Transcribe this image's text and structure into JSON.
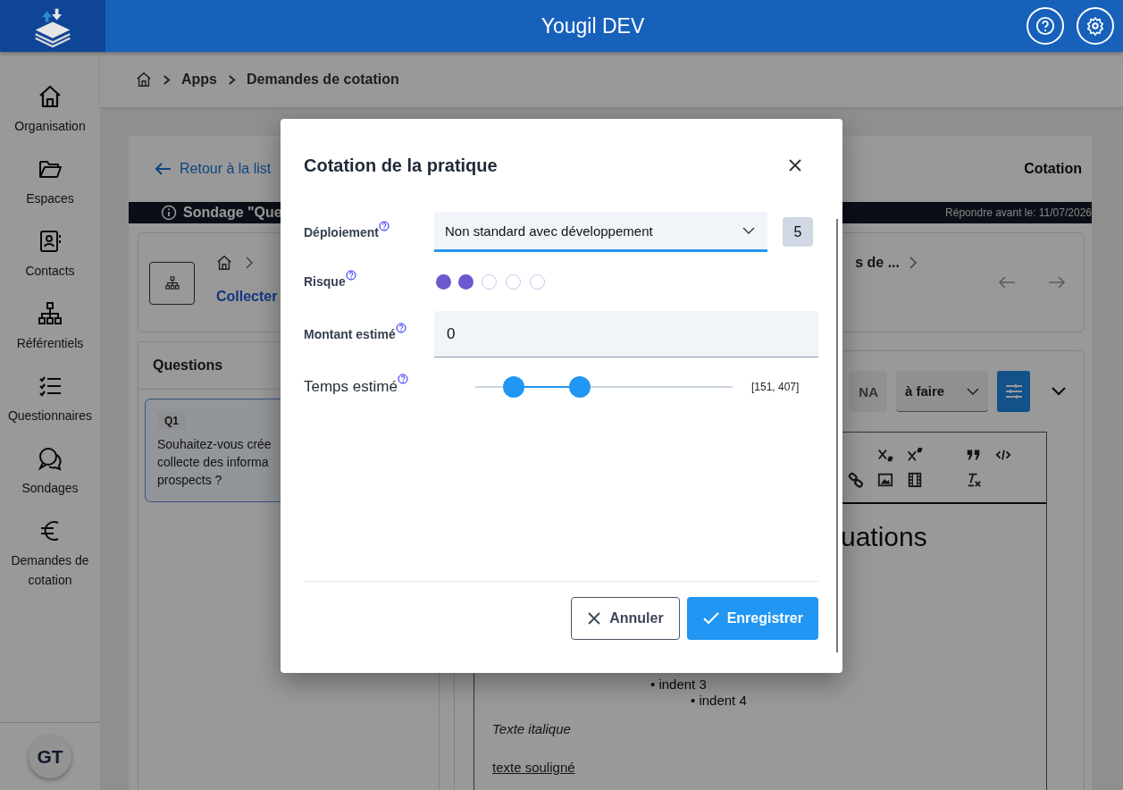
{
  "header": {
    "title": "Yougil DEV"
  },
  "sidebar": {
    "items": [
      {
        "label": "Organisation",
        "kind": "home"
      },
      {
        "label": "Espaces",
        "kind": "folder"
      },
      {
        "label": "Contacts",
        "kind": "contact"
      },
      {
        "label": "Référentiels",
        "kind": "tree"
      },
      {
        "label": "Questionnaires",
        "kind": "checklist"
      },
      {
        "label": "Sondages",
        "kind": "chat"
      },
      {
        "label": "Demandes de cotation",
        "kind": "euro"
      }
    ],
    "avatar": "GT"
  },
  "breadcrumb": [
    "Apps",
    "Demandes de cotation"
  ],
  "page": {
    "back_link": "Retour à la list",
    "title": "Cotation",
    "banner": {
      "text": "Sondage \"Que",
      "deadline": "Répondre avant le: 11/07/2026"
    },
    "path": {
      "title": "Collecter",
      "crumb": "s de ..."
    },
    "questions": {
      "title": "Questions",
      "items": [
        {
          "code": "Q1",
          "lines": [
            "Souhaitez-vous crée",
            "collecte des informa",
            "prospects ?"
          ]
        }
      ]
    },
    "answer": {
      "na": "NA",
      "status": "à faire",
      "editor": {
        "heading": "uations",
        "bullets": [
          "• indent 3",
          "• indent 4"
        ],
        "italic": "Texte italique",
        "underlined": "texte souligné"
      }
    }
  },
  "modal": {
    "title": "Cotation de la pratique",
    "fields": [
      {
        "kind": "select",
        "label": "Déploiement",
        "value": "Non standard avec développement",
        "score": "5"
      },
      {
        "kind": "rating",
        "label": "Risque",
        "stars": 2
      },
      {
        "kind": "input",
        "label": "Montant estimé",
        "value": "0"
      },
      {
        "kind": "range",
        "label": "Temps estimé",
        "thumbs": [
          {
            "level": 0.151
          },
          {
            "level": 0.407
          }
        ],
        "reading": "[151, 407]"
      }
    ],
    "buttons": [
      {
        "kind": "cancel",
        "label": "Annuler"
      },
      {
        "kind": "save",
        "label": "Enregistrer"
      }
    ]
  }
}
